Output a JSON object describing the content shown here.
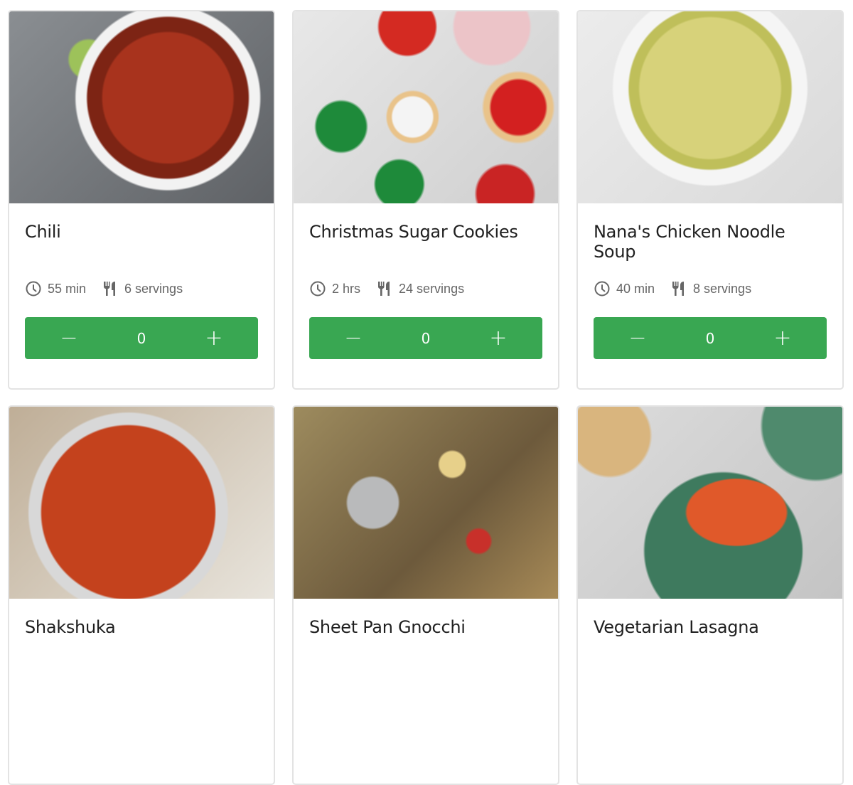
{
  "recipes": [
    {
      "title": "Chili",
      "time": "55 min",
      "servings": "6 servings",
      "quantity": "0",
      "image": "chili-photo"
    },
    {
      "title": "Christmas Sugar Cookies",
      "time": "2 hrs",
      "servings": "24 servings",
      "quantity": "0",
      "image": "cookies-photo"
    },
    {
      "title": "Nana's Chicken Noodle Soup",
      "time": "40 min",
      "servings": "8 servings",
      "quantity": "0",
      "image": "soup-photo"
    },
    {
      "title": "Shakshuka",
      "image": "shakshuka-photo"
    },
    {
      "title": "Sheet Pan Gnocchi",
      "image": "gnocchi-photo"
    },
    {
      "title": "Vegetarian Lasagna",
      "image": "lasagna-photo"
    }
  ],
  "stepper": {
    "minus": "−",
    "plus": "+"
  },
  "icons": {
    "time": "clock-icon",
    "servings": "fork-knife-icon"
  },
  "colors": {
    "accent": "#39a752",
    "meta_text": "#666666",
    "title_text": "#1f1f1f",
    "card_border": "#e3e3e3"
  }
}
